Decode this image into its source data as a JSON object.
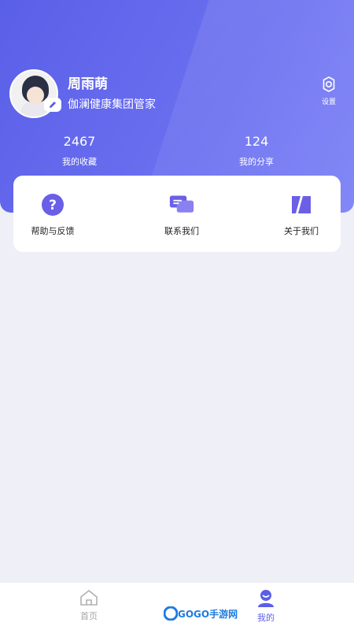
{
  "profile": {
    "name": "周雨萌",
    "organization": "伽澜健康集团管家"
  },
  "settings": {
    "label": "设置"
  },
  "stats": [
    {
      "value": "2467",
      "label": "我的收藏"
    },
    {
      "value": "124",
      "label": "我的分享"
    }
  ],
  "actions": [
    {
      "label": "帮助与反馈",
      "icon": "help-icon"
    },
    {
      "label": "联系我们",
      "icon": "chat-icon"
    },
    {
      "label": "关于我们",
      "icon": "about-icon"
    }
  ],
  "tabbar": {
    "items": [
      {
        "label": "首页",
        "icon": "home-icon",
        "active": false
      },
      {
        "label": "我的",
        "icon": "user-icon",
        "active": true
      }
    ]
  },
  "watermark": {
    "text": "GOGO手游网"
  },
  "colors": {
    "accent": "#5a5fe8",
    "background": "#eeeff7"
  }
}
